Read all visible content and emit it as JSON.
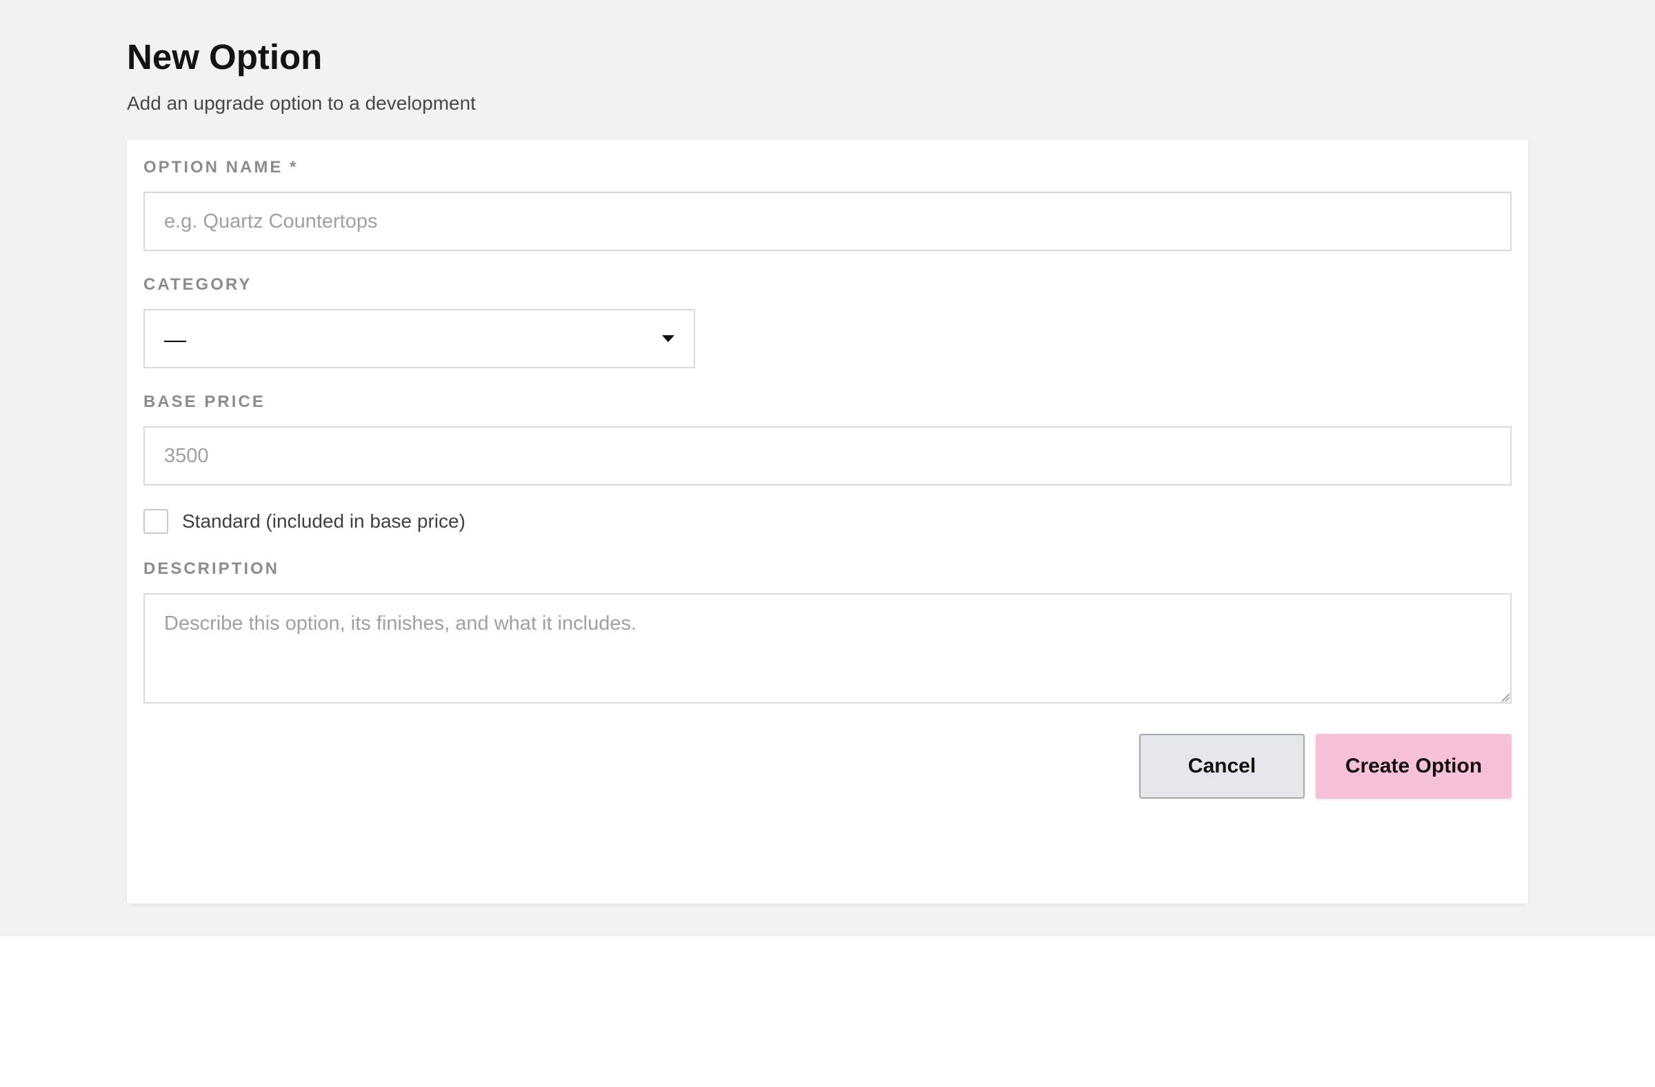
{
  "header": {
    "title": "New Option",
    "subtitle": "Add an upgrade option to a development"
  },
  "form": {
    "option_name": {
      "label": "OPTION NAME *",
      "value": "",
      "placeholder": "e.g. Quartz Countertops"
    },
    "category": {
      "label": "CATEGORY",
      "selected": "—"
    },
    "base_price": {
      "label": "BASE PRICE",
      "value": "",
      "placeholder": "3500"
    },
    "standard": {
      "label": "Standard (included in base price)",
      "checked": false
    },
    "description": {
      "label": "DESCRIPTION",
      "value": "",
      "placeholder": "Describe this option, its finishes, and what it includes."
    }
  },
  "actions": {
    "cancel_label": "Cancel",
    "create_label": "Create Option"
  },
  "colors": {
    "background": "#f2f2f2",
    "card": "#ffffff",
    "primary_button": "#f5c0d8",
    "secondary_button": "#e3e6ea"
  }
}
